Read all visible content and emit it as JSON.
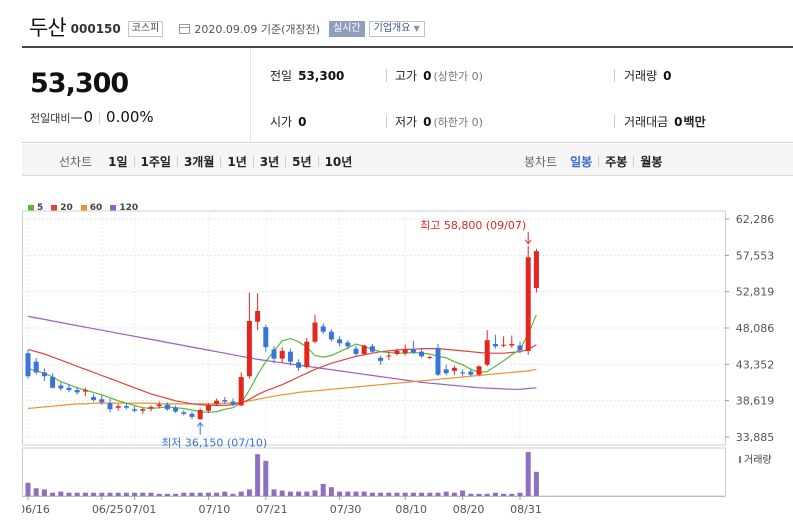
{
  "header": {
    "stock_name": "두산",
    "stock_code": "000150",
    "market_badge": "코스피",
    "date": "2020.09.09",
    "date_note": "기준(개장전)",
    "realtime_badge": "실시간",
    "company_info_button": "기업개요"
  },
  "summary": {
    "price": "53,300",
    "change_label": "전일대비",
    "change_value": "0",
    "change_pct": "0.00%",
    "prev_close_label": "전일",
    "prev_close": "53,300",
    "high_label": "고가",
    "high": "0",
    "high_note": "(상한가 0)",
    "volume_label": "거래량",
    "volume": "0",
    "open_label": "시가",
    "open": "0",
    "low_label": "저가",
    "low": "0",
    "low_note": "(하한가 0)",
    "amount_label": "거래대금",
    "amount": "0",
    "amount_unit": "백만"
  },
  "toolbar": {
    "line_chart_label": "선차트",
    "line_periods": [
      "1일",
      "1주일",
      "3개월",
      "1년",
      "3년",
      "5년",
      "10년"
    ],
    "candle_chart_label": "봉차트",
    "candle_periods": [
      "일봉",
      "주봉",
      "월봉"
    ],
    "active_candle_period": "일봉"
  },
  "colors": {
    "up": "#e5261f",
    "down": "#3b74d8",
    "ma5": "#5ab73a",
    "ma20": "#e8413a",
    "ma60": "#f4902b",
    "ma120": "#9b5fc6",
    "volume": "#8e6fc0"
  },
  "chart_data": {
    "type": "candlestick",
    "legend": [
      {
        "label": "5",
        "color": "#5ab73a"
      },
      {
        "label": "20",
        "color": "#e8413a"
      },
      {
        "label": "60",
        "color": "#f4902b"
      },
      {
        "label": "120",
        "color": "#9b5fc6"
      }
    ],
    "y_ticks": [
      "62,286",
      "57,553",
      "52,819",
      "48,086",
      "43,352",
      "38,619",
      "33,885"
    ],
    "ylim": [
      33885,
      62286
    ],
    "x_tick_labels": [
      "06/16",
      "06/25",
      "07/01",
      "07/10",
      "07/21",
      "07/30",
      "08/10",
      "08/20",
      "08/31"
    ],
    "max_annotation": "최고 58,800 (09/07)",
    "min_annotation": "최저 36,150 (07/10)",
    "volume_label": "거래량",
    "candles": [
      {
        "o": 44800,
        "h": 45200,
        "l": 41500,
        "c": 41800
      },
      {
        "o": 43700,
        "h": 44200,
        "l": 42000,
        "c": 42300
      },
      {
        "o": 42300,
        "h": 42800,
        "l": 41200,
        "c": 41800
      },
      {
        "o": 41700,
        "h": 42200,
        "l": 40200,
        "c": 40300
      },
      {
        "o": 40600,
        "h": 41000,
        "l": 39900,
        "c": 40200
      },
      {
        "o": 40300,
        "h": 40800,
        "l": 39700,
        "c": 40000
      },
      {
        "o": 40000,
        "h": 40400,
        "l": 39400,
        "c": 39700
      },
      {
        "o": 39800,
        "h": 40300,
        "l": 39200,
        "c": 40000
      },
      {
        "o": 39100,
        "h": 39500,
        "l": 38500,
        "c": 38700
      },
      {
        "o": 38800,
        "h": 39300,
        "l": 38100,
        "c": 38400
      },
      {
        "o": 38300,
        "h": 38900,
        "l": 37100,
        "c": 37500
      },
      {
        "o": 37700,
        "h": 38200,
        "l": 37300,
        "c": 37900
      },
      {
        "o": 37900,
        "h": 38300,
        "l": 37500,
        "c": 37700
      },
      {
        "o": 37500,
        "h": 37900,
        "l": 37100,
        "c": 37300
      },
      {
        "o": 37300,
        "h": 37700,
        "l": 36900,
        "c": 37500
      },
      {
        "o": 37600,
        "h": 38000,
        "l": 37200,
        "c": 37800
      },
      {
        "o": 37900,
        "h": 38500,
        "l": 37600,
        "c": 38100
      },
      {
        "o": 38100,
        "h": 38400,
        "l": 37300,
        "c": 37500
      },
      {
        "o": 37700,
        "h": 38000,
        "l": 37000,
        "c": 37200
      },
      {
        "o": 37100,
        "h": 37400,
        "l": 36700,
        "c": 36900
      },
      {
        "o": 36900,
        "h": 37200,
        "l": 36200,
        "c": 36500
      },
      {
        "o": 36200,
        "h": 37600,
        "l": 36150,
        "c": 37400
      },
      {
        "o": 37300,
        "h": 38300,
        "l": 37000,
        "c": 38000
      },
      {
        "o": 38200,
        "h": 38900,
        "l": 37900,
        "c": 38600
      },
      {
        "o": 38700,
        "h": 39100,
        "l": 38200,
        "c": 38500
      },
      {
        "o": 38500,
        "h": 38900,
        "l": 37900,
        "c": 38100
      },
      {
        "o": 38000,
        "h": 42300,
        "l": 37900,
        "c": 41700
      },
      {
        "o": 41800,
        "h": 52700,
        "l": 41500,
        "c": 49000
      },
      {
        "o": 48900,
        "h": 52600,
        "l": 47800,
        "c": 50300
      },
      {
        "o": 48200,
        "h": 48500,
        "l": 45000,
        "c": 45600
      },
      {
        "o": 45300,
        "h": 45700,
        "l": 43500,
        "c": 44100
      },
      {
        "o": 44100,
        "h": 45600,
        "l": 43500,
        "c": 45100
      },
      {
        "o": 45000,
        "h": 45400,
        "l": 43200,
        "c": 43700
      },
      {
        "o": 43600,
        "h": 44000,
        "l": 42500,
        "c": 42900
      },
      {
        "o": 43000,
        "h": 46800,
        "l": 42800,
        "c": 46300
      },
      {
        "o": 46300,
        "h": 49800,
        "l": 46100,
        "c": 48800
      },
      {
        "o": 48300,
        "h": 48700,
        "l": 47300,
        "c": 47600
      },
      {
        "o": 47600,
        "h": 47900,
        "l": 46300,
        "c": 46600
      },
      {
        "o": 46600,
        "h": 47000,
        "l": 45700,
        "c": 46100
      },
      {
        "o": 46200,
        "h": 46500,
        "l": 45300,
        "c": 45700
      },
      {
        "o": 45400,
        "h": 45800,
        "l": 44300,
        "c": 44700
      },
      {
        "o": 44700,
        "h": 45900,
        "l": 44500,
        "c": 45800
      },
      {
        "o": 45700,
        "h": 46000,
        "l": 44800,
        "c": 45000
      },
      {
        "o": 44200,
        "h": 44500,
        "l": 43300,
        "c": 43800
      },
      {
        "o": 44400,
        "h": 44900,
        "l": 43900,
        "c": 44500
      },
      {
        "o": 44700,
        "h": 45400,
        "l": 44500,
        "c": 45100
      },
      {
        "o": 44800,
        "h": 45900,
        "l": 44500,
        "c": 45300
      },
      {
        "o": 45300,
        "h": 46400,
        "l": 44700,
        "c": 44900
      },
      {
        "o": 45000,
        "h": 45400,
        "l": 44200,
        "c": 44400
      },
      {
        "o": 44200,
        "h": 44500,
        "l": 44000,
        "c": 44300
      },
      {
        "o": 45500,
        "h": 46000,
        "l": 41800,
        "c": 42000
      },
      {
        "o": 42700,
        "h": 43300,
        "l": 41900,
        "c": 42200
      },
      {
        "o": 42500,
        "h": 43200,
        "l": 42000,
        "c": 42900
      },
      {
        "o": 42300,
        "h": 42700,
        "l": 41800,
        "c": 42200
      },
      {
        "o": 42400,
        "h": 42800,
        "l": 41800,
        "c": 42000
      },
      {
        "o": 42000,
        "h": 43200,
        "l": 41900,
        "c": 43100
      },
      {
        "o": 43300,
        "h": 47800,
        "l": 43100,
        "c": 46500
      },
      {
        "o": 46000,
        "h": 47200,
        "l": 45400,
        "c": 45700
      },
      {
        "o": 45900,
        "h": 47000,
        "l": 45600,
        "c": 45900
      },
      {
        "o": 45800,
        "h": 47100,
        "l": 45500,
        "c": 46000
      },
      {
        "o": 45800,
        "h": 46300,
        "l": 44800,
        "c": 45200
      },
      {
        "o": 45100,
        "h": 58800,
        "l": 44600,
        "c": 57300
      },
      {
        "o": 53300,
        "h": 58400,
        "l": 52700,
        "c": 58100
      }
    ],
    "ma5": [
      42800,
      42500,
      42200,
      41700,
      41100,
      40700,
      40300,
      40000,
      39700,
      39400,
      39000,
      38600,
      38300,
      38000,
      37700,
      37600,
      37700,
      37800,
      37700,
      37600,
      37400,
      37200,
      37100,
      37200,
      37500,
      37700,
      38300,
      40000,
      42000,
      43700,
      45100,
      46400,
      46700,
      46300,
      45600,
      44500,
      44300,
      44500,
      45000,
      45500,
      46000,
      45700,
      45300,
      45000,
      44900,
      44800,
      44800,
      44900,
      44800,
      44700,
      44400,
      44200,
      43700,
      43300,
      42700,
      42300,
      42400,
      43100,
      43800,
      44600,
      45300,
      47300,
      49800
    ],
    "ma20": [
      45300,
      45000,
      44700,
      44300,
      43900,
      43500,
      43100,
      42700,
      42300,
      41900,
      41500,
      41100,
      40700,
      40300,
      39900,
      39500,
      39200,
      38900,
      38600,
      38400,
      38200,
      38100,
      38000,
      38000,
      38000,
      38100,
      38300,
      38800,
      39400,
      39900,
      40300,
      40700,
      41200,
      41700,
      42200,
      42700,
      43100,
      43500,
      43800,
      44100,
      44400,
      44600,
      44800,
      45000,
      45100,
      45200,
      45300,
      45300,
      45400,
      45400,
      45400,
      45300,
      45200,
      45100,
      45000,
      44900,
      44800,
      44800,
      44800,
      44900,
      45000,
      45300,
      45900
    ],
    "ma60": [
      37600,
      37700,
      37800,
      37900,
      38000,
      38100,
      38200,
      38200,
      38300,
      38300,
      38300,
      38300,
      38300,
      38300,
      38300,
      38300,
      38200,
      38200,
      38200,
      38200,
      38200,
      38200,
      38200,
      38200,
      38300,
      38300,
      38400,
      38600,
      38800,
      39000,
      39200,
      39400,
      39500,
      39700,
      39800,
      39900,
      40000,
      40100,
      40200,
      40300,
      40400,
      40500,
      40600,
      40700,
      40800,
      40900,
      41000,
      41100,
      41200,
      41300,
      41400,
      41500,
      41600,
      41700,
      41800,
      41900,
      42000,
      42100,
      42200,
      42300,
      42400,
      42500,
      42700
    ],
    "ma120": [
      49600,
      49400,
      49200,
      49000,
      48800,
      48600,
      48400,
      48200,
      48000,
      47800,
      47600,
      47400,
      47200,
      47000,
      46800,
      46600,
      46400,
      46200,
      46000,
      45800,
      45600,
      45400,
      45200,
      45000,
      44800,
      44600,
      44400,
      44200,
      44000,
      43850,
      43700,
      43550,
      43400,
      43250,
      43100,
      42950,
      42800,
      42650,
      42500,
      42350,
      42200,
      42050,
      41900,
      41750,
      41600,
      41450,
      41300,
      41150,
      41000,
      40900,
      40800,
      40700,
      40600,
      40500,
      40400,
      40300,
      40250,
      40200,
      40150,
      40100,
      40100,
      40200,
      40300
    ],
    "volume": [
      12,
      7,
      6,
      3,
      4,
      3,
      3,
      3,
      3,
      3,
      3,
      3,
      3,
      3,
      3,
      3,
      2,
      2,
      2,
      3,
      3,
      3,
      3,
      3,
      4,
      2,
      4,
      6,
      38,
      32,
      6,
      5,
      4,
      4,
      4,
      5,
      11,
      8,
      4,
      4,
      4,
      4,
      3,
      3,
      3,
      3,
      3,
      3,
      3,
      3,
      3,
      4,
      3,
      5,
      2,
      2,
      2,
      3,
      2,
      2,
      3,
      40,
      22
    ]
  }
}
